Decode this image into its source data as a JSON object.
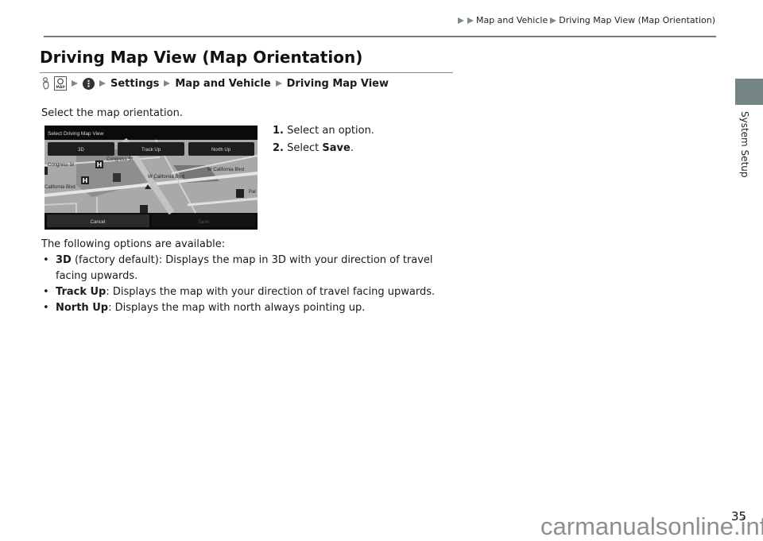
{
  "breadcrumb": {
    "items": [
      "Map and Vehicle",
      "Driving Map View (Map Orientation)"
    ]
  },
  "page": {
    "title": "Driving Map View (Map Orientation)",
    "nav_path": {
      "icons": [
        "voice-hand-icon",
        "map-button-icon",
        "more-menu-icon"
      ],
      "items": [
        "Settings",
        "Map and Vehicle",
        "Driving Map View"
      ]
    },
    "intro": "Select the map orientation.",
    "steps": [
      {
        "num": "1.",
        "text": "Select an option.",
        "bold": ""
      },
      {
        "num": "2.",
        "text": "Select ",
        "bold": "Save",
        "suffix": "."
      }
    ],
    "options_intro": "The following options are available:",
    "options": [
      {
        "name": "3D",
        "desc": " (factory default): Displays the map in 3D with your direction of travel facing upwards."
      },
      {
        "name": "Track Up",
        "desc": ": Displays the map with your direction of travel facing upwards."
      },
      {
        "name": "North Up",
        "desc": ": Displays the map with north always pointing up."
      }
    ]
  },
  "screenshot": {
    "header": "Select Driving Map View",
    "buttons": [
      "3D",
      "Track Up",
      "North Up"
    ],
    "streets": [
      "Congress St",
      "Congress St",
      "W California Blvd",
      "W California Blvd",
      "California Blvd",
      "Pal"
    ],
    "footer_buttons": [
      "Cancel",
      "Save"
    ]
  },
  "side_tab": {
    "label": "System Setup",
    "color": "#758585"
  },
  "page_number": "35",
  "watermark": "carmanualsonline.info"
}
